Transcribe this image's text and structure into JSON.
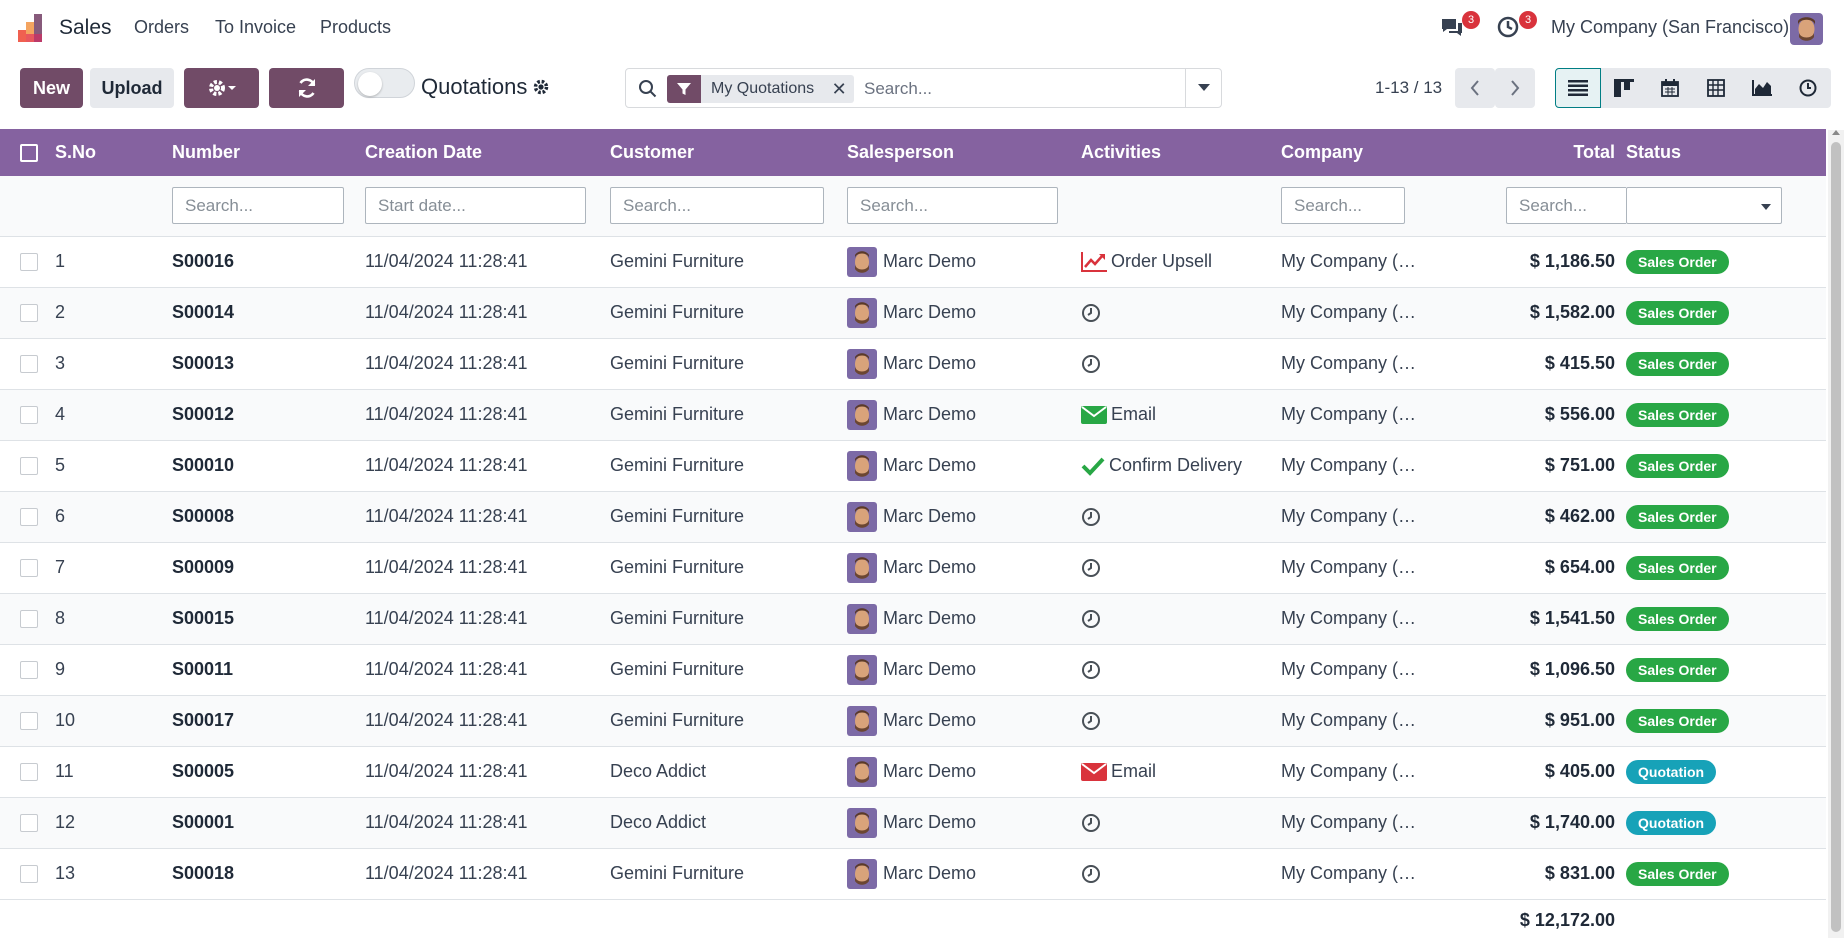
{
  "app": {
    "name": "Sales"
  },
  "nav": {
    "items": [
      "Orders",
      "To Invoice",
      "Products"
    ]
  },
  "systray": {
    "messages_count": "3",
    "activities_count": "3",
    "company": "My Company (San Francisco)"
  },
  "toolbar": {
    "new_label": "New",
    "upload_label": "Upload",
    "title": "Quotations"
  },
  "search": {
    "facet": "My Quotations",
    "placeholder": "Search..."
  },
  "pager": {
    "value": "1-13 / 13"
  },
  "views": [
    "list-icon",
    "kanban-icon",
    "calendar-icon",
    "pivot-icon",
    "graph-icon",
    "activity-icon"
  ],
  "columns": {
    "sno": "S.No",
    "number": "Number",
    "date": "Creation Date",
    "customer": "Customer",
    "salesperson": "Salesperson",
    "activities": "Activities",
    "company": "Company",
    "total": "Total",
    "status": "Status"
  },
  "filters": {
    "number": "Search...",
    "date": "Start date...",
    "customer": "Search...",
    "salesperson": "Search...",
    "company": "Search...",
    "total": "Search..."
  },
  "rows": [
    {
      "sno": "1",
      "number": "S00016",
      "date": "11/04/2024 11:28:41",
      "customer": "Gemini Furniture",
      "salesperson": "Marc Demo",
      "activity_icon": "chart-line-icon",
      "activity": "Order Upsell",
      "company": "My Company (…",
      "total": "$ 1,186.50",
      "status": "Sales Order"
    },
    {
      "sno": "2",
      "number": "S00014",
      "date": "11/04/2024 11:28:41",
      "customer": "Gemini Furniture",
      "salesperson": "Marc Demo",
      "activity_icon": "clock-icon",
      "activity": "",
      "company": "My Company (…",
      "total": "$ 1,582.00",
      "status": "Sales Order"
    },
    {
      "sno": "3",
      "number": "S00013",
      "date": "11/04/2024 11:28:41",
      "customer": "Gemini Furniture",
      "salesperson": "Marc Demo",
      "activity_icon": "clock-icon",
      "activity": "",
      "company": "My Company (…",
      "total": "$ 415.50",
      "status": "Sales Order"
    },
    {
      "sno": "4",
      "number": "S00012",
      "date": "11/04/2024 11:28:41",
      "customer": "Gemini Furniture",
      "salesperson": "Marc Demo",
      "activity_icon": "envelope-green-icon",
      "activity": "Email",
      "company": "My Company (…",
      "total": "$ 556.00",
      "status": "Sales Order"
    },
    {
      "sno": "5",
      "number": "S00010",
      "date": "11/04/2024 11:28:41",
      "customer": "Gemini Furniture",
      "salesperson": "Marc Demo",
      "activity_icon": "check-icon",
      "activity": "Confirm Delivery",
      "company": "My Company (…",
      "total": "$ 751.00",
      "status": "Sales Order"
    },
    {
      "sno": "6",
      "number": "S00008",
      "date": "11/04/2024 11:28:41",
      "customer": "Gemini Furniture",
      "salesperson": "Marc Demo",
      "activity_icon": "clock-icon",
      "activity": "",
      "company": "My Company (…",
      "total": "$ 462.00",
      "status": "Sales Order"
    },
    {
      "sno": "7",
      "number": "S00009",
      "date": "11/04/2024 11:28:41",
      "customer": "Gemini Furniture",
      "salesperson": "Marc Demo",
      "activity_icon": "clock-icon",
      "activity": "",
      "company": "My Company (…",
      "total": "$ 654.00",
      "status": "Sales Order"
    },
    {
      "sno": "8",
      "number": "S00015",
      "date": "11/04/2024 11:28:41",
      "customer": "Gemini Furniture",
      "salesperson": "Marc Demo",
      "activity_icon": "clock-icon",
      "activity": "",
      "company": "My Company (…",
      "total": "$ 1,541.50",
      "status": "Sales Order"
    },
    {
      "sno": "9",
      "number": "S00011",
      "date": "11/04/2024 11:28:41",
      "customer": "Gemini Furniture",
      "salesperson": "Marc Demo",
      "activity_icon": "clock-icon",
      "activity": "",
      "company": "My Company (…",
      "total": "$ 1,096.50",
      "status": "Sales Order"
    },
    {
      "sno": "10",
      "number": "S00017",
      "date": "11/04/2024 11:28:41",
      "customer": "Gemini Furniture",
      "salesperson": "Marc Demo",
      "activity_icon": "clock-icon",
      "activity": "",
      "company": "My Company (…",
      "total": "$ 951.00",
      "status": "Sales Order"
    },
    {
      "sno": "11",
      "number": "S00005",
      "date": "11/04/2024 11:28:41",
      "customer": "Deco Addict",
      "salesperson": "Marc Demo",
      "activity_icon": "envelope-red-icon",
      "activity": "Email",
      "company": "My Company (…",
      "total": "$ 405.00",
      "status": "Quotation"
    },
    {
      "sno": "12",
      "number": "S00001",
      "date": "11/04/2024 11:28:41",
      "customer": "Deco Addict",
      "salesperson": "Marc Demo",
      "activity_icon": "clock-icon",
      "activity": "",
      "company": "My Company (…",
      "total": "$ 1,740.00",
      "status": "Quotation"
    },
    {
      "sno": "13",
      "number": "S00018",
      "date": "11/04/2024 11:28:41",
      "customer": "Gemini Furniture",
      "salesperson": "Marc Demo",
      "activity_icon": "clock-icon",
      "activity": "",
      "company": "My Company (…",
      "total": "$ 831.00",
      "status": "Sales Order"
    }
  ],
  "grand_total": "$ 12,172.00",
  "colors": {
    "brand": "#714b67",
    "header": "#8562a0",
    "sales_order": "#28a745",
    "quotation": "#17a2b8"
  }
}
